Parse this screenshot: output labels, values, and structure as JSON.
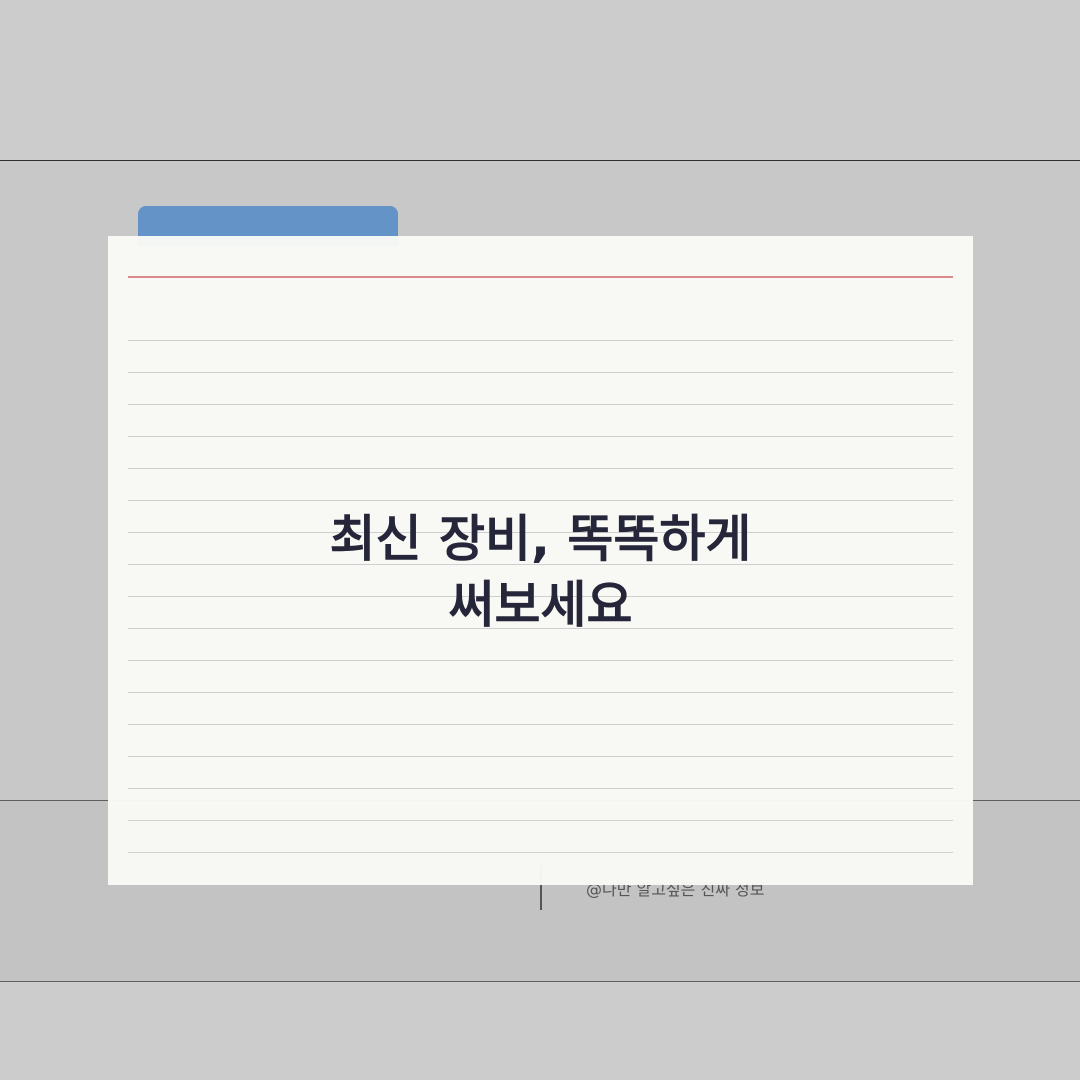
{
  "headline": {
    "line1": "최신 장비, 똑똑하게",
    "line2": "써보세요"
  },
  "footer": {
    "credit": "@나만 알고싶은 진짜 정보"
  },
  "colors": {
    "tab": "#6493c8",
    "margin_line": "#d98a8a",
    "headline_text": "#26263a",
    "card": "#f9f9f5",
    "background": "#cccccc"
  }
}
